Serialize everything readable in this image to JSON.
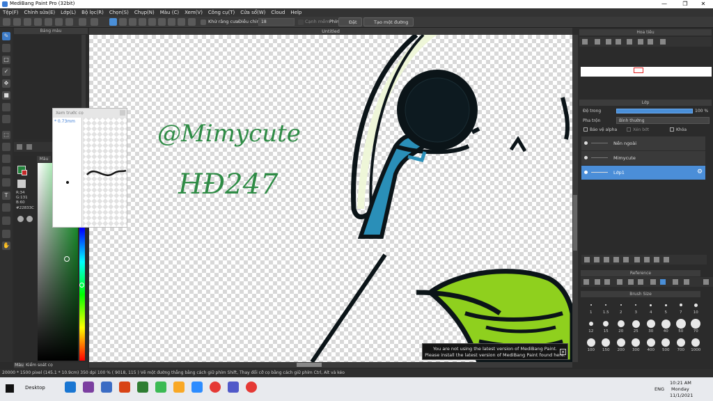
{
  "window": {
    "title": "MediBang Paint Pro (32bit)",
    "minimize": "—",
    "maximize": "❐",
    "close": "✕"
  },
  "menu": [
    "Tệp(F)",
    "Chỉnh sửa(E)",
    "Lớp(L)",
    "Bộ lọc(R)",
    "Chọn(S)",
    "Chụp(N)",
    "Màu (C)",
    "Xem(V)",
    "Công cụ(T)",
    "Cửa sổ(W)",
    "Cloud",
    "Help"
  ],
  "toolbar": {
    "antialias_label": "Khử răng cưa",
    "adjust_label": "Điều chỉnh",
    "adjust_value": "18",
    "edge_label": "Cạnh mềm",
    "phim_label": "Phím",
    "reset_label": "Đặt lại",
    "straight_line_label": "Tạo một đường thẳng"
  },
  "canvas": {
    "tab_title": "Untitled",
    "text1": "@Mimycute",
    "text2": "HĐ247"
  },
  "brush_panel": {
    "title": "Bảng màu"
  },
  "brush_preview": {
    "title": "Xem trước cọ",
    "size": "* 0.73mm"
  },
  "color_panel": {
    "title": "Màu",
    "r": "R:34",
    "g": "G:131",
    "b": "B:60",
    "hex": "#22833C",
    "tab1": "Màu",
    "tab2": "Kiểm soát cọ"
  },
  "navigator": {
    "title": "Hoa tiêu"
  },
  "layers": {
    "title": "Lớp",
    "opacity_label": "Độ trong",
    "opacity_value": "100 %",
    "blend_label": "Pha trộn",
    "blend_value": "Bình thường",
    "protect_alpha": "Bảo vệ alpha",
    "clipping": "Xén bớt",
    "lock": "Khóa",
    "items": [
      "Nền ngoài",
      "Mimycute",
      "Lớp1"
    ]
  },
  "reference": {
    "title": "Reference"
  },
  "brush_size": {
    "title": "Brush Size",
    "sizes": [
      "1",
      "1.5",
      "2",
      "3",
      "4",
      "5",
      "7",
      "10",
      "12",
      "15",
      "20",
      "25",
      "30",
      "40",
      "50",
      "70",
      "100",
      "150",
      "200",
      "300",
      "400",
      "500",
      "700",
      "1000"
    ]
  },
  "notice": {
    "line1": "You are not using the latest version of MediBang Paint.",
    "line2": "Please install the latest version of MediBang Paint found here."
  },
  "status": {
    "text": "20000 * 1500 pixel  (145.1 * 10.9cm)  350 dpi  100 %  ( 9018, 115 )  Vẽ một đường thẳng bằng cách giữ phím Shift, Thay đổi cỡ cọ bằng cách giữ phím Ctrl, Alt và kéo"
  },
  "taskbar": {
    "desktop_label": "Desktop",
    "lang": "ENG",
    "time": "10:21 AM",
    "day": "Monday",
    "date": "11/1/2021"
  },
  "colors": {
    "accent": "#4a8fd8",
    "current_color": "#22833C"
  }
}
